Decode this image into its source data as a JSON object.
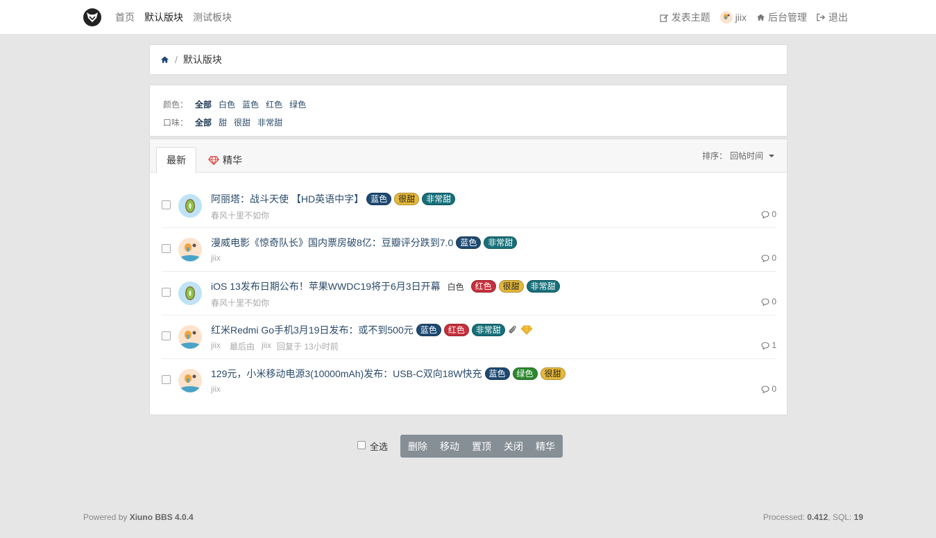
{
  "nav": {
    "left": [
      "首页",
      "默认版块",
      "测试板块"
    ],
    "active_index": 1,
    "new_thread": "发表主题",
    "username": "jiix",
    "admin": "后台管理",
    "logout": "退出"
  },
  "breadcrumb": {
    "current": "默认版块"
  },
  "filters": {
    "color": {
      "label": "颜色：",
      "options": [
        "全部",
        "白色",
        "蓝色",
        "红色",
        "绿色"
      ]
    },
    "taste": {
      "label": "口味：",
      "options": [
        "全部",
        "甜",
        "很甜",
        "非常甜"
      ]
    }
  },
  "tabs": {
    "latest": "最新",
    "digest": "精华"
  },
  "sort": {
    "label": "排序：",
    "value": "回帖时间"
  },
  "threads": [
    {
      "title": "阿丽塔：战斗天使 【HD英语中字】",
      "plain": "",
      "tags": [
        "蓝色",
        "很甜",
        "非常甜"
      ],
      "author": "春风十里不如你",
      "last_by": "",
      "last_time": "",
      "replies": "0"
    },
    {
      "title": "漫威电影《惊奇队长》国内票房破8亿：豆瓣评分跌到7.0",
      "plain": "",
      "tags": [
        "蓝色",
        "非常甜"
      ],
      "author": "jiix",
      "last_by": "",
      "last_time": "",
      "replies": "0"
    },
    {
      "title": "iOS 13发布日期公布！苹果WWDC19将于6月3日开幕",
      "plain": "白色",
      "tags": [
        "红色",
        "很甜",
        "非常甜"
      ],
      "author": "春风十里不如你",
      "last_by": "",
      "last_time": "",
      "replies": "0"
    },
    {
      "title": "红米Redmi Go手机3月19日发布：或不到500元",
      "plain": "",
      "tags": [
        "蓝色",
        "红色",
        "非常甜"
      ],
      "author": "jiix",
      "last_by_label": "最后由",
      "last_by": "jiix",
      "last_time": "回复于 13小时前",
      "replies": "1"
    },
    {
      "title": "129元，小米移动电源3(10000mAh)发布：USB-C双向18W快充",
      "plain": "",
      "tags": [
        "蓝色",
        "绿色",
        "很甜"
      ],
      "author": "jiix",
      "last_by": "",
      "last_time": "",
      "replies": "0"
    }
  ],
  "actions": {
    "select_all": "全选",
    "buttons": [
      "删除",
      "移动",
      "置顶",
      "关闭",
      "精华"
    ]
  },
  "footer": {
    "powered_prefix": "Powered by ",
    "powered_name": "Xiuno BBS 4.0.4",
    "processed_label": "Processed: ",
    "processed": "0.412",
    "sql_label": ", SQL: ",
    "sql": "19"
  },
  "colors": {
    "accent": "#2a4a6a",
    "blue": "#1e4a72",
    "yellow": "#e6b93a",
    "teal": "#16707a",
    "red": "#c6303c",
    "green": "#2c8a2e"
  }
}
